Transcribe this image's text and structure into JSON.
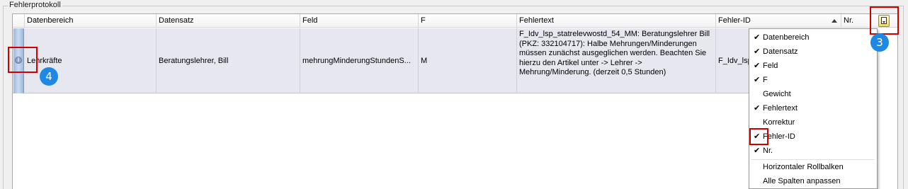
{
  "groupbox": {
    "title": "Fehlerprotokoll"
  },
  "columns": [
    {
      "label": "Datenbereich"
    },
    {
      "label": "Datensatz"
    },
    {
      "label": "Feld"
    },
    {
      "label": "F"
    },
    {
      "label": "Fehlertext"
    },
    {
      "label": "Fehler-ID",
      "sorted": "ascending"
    },
    {
      "label": "Nr."
    }
  ],
  "row": {
    "datenbereich": "Lehrkräfte",
    "datensatz": "Beratungslehrer, Bill",
    "feld": "mehrungMinderungStundenS...",
    "f": "M",
    "fehlertext": "F_Idv_lsp_statrelevwostd_54_MM: Beratungslehrer Bill (PKZ: 332104717): Halbe Mehrungen/Minderungen müssen zunächst ausgeglichen werden. Beachten Sie hierzu den Artikel unter -> Lehrer -> Mehrung/Minderung. (derzeit 0,5 Stunden)",
    "fehler_id": "F_Idv_lsp"
  },
  "column_menu": {
    "items": [
      {
        "label": "Datenbereich",
        "checked": true
      },
      {
        "label": "Datensatz",
        "checked": true
      },
      {
        "label": "Feld",
        "checked": true
      },
      {
        "label": "F",
        "checked": true
      },
      {
        "label": "Gewicht",
        "checked": false
      },
      {
        "label": "Fehlertext",
        "checked": true
      },
      {
        "label": "Korrektur",
        "checked": false
      },
      {
        "label": "Fehler-ID",
        "checked": true
      },
      {
        "label": "Nr.",
        "checked": true
      }
    ],
    "actions": [
      {
        "label": "Horizontaler Rollbalken"
      },
      {
        "label": "Alle Spalten anpassen"
      }
    ],
    "check_glyph": "✔"
  },
  "callouts": {
    "badge_3": "3",
    "badge_4": "4"
  },
  "colors": {
    "callout_border": "#d00000",
    "badge": "#1e88e5",
    "row_background": "#e7e7ef",
    "row_selector": "#9db8dc"
  }
}
